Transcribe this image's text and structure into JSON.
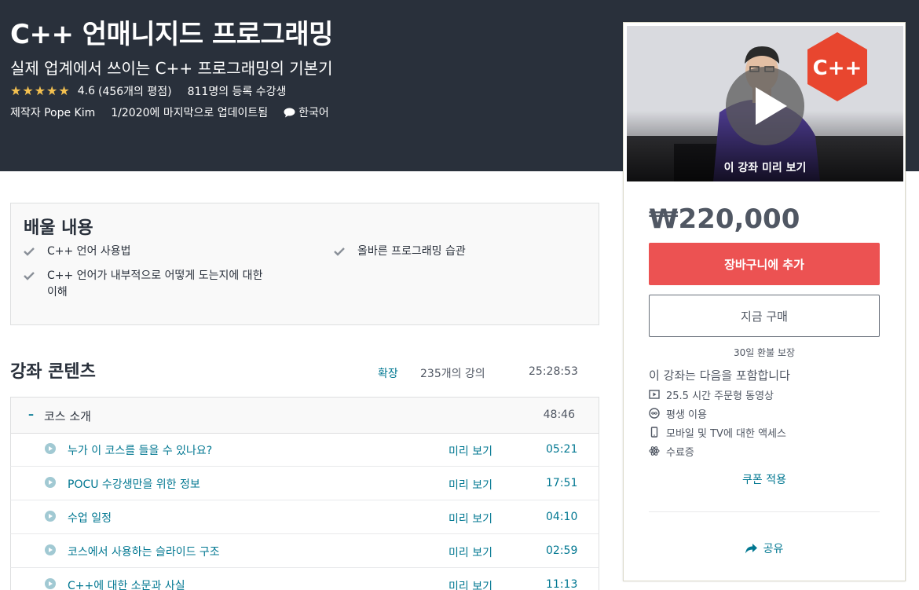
{
  "course": {
    "title": "C++ 언매니지드 프로그래밍",
    "subtitle": "실제 업계에서 쓰이는 C++ 프로그래밍의 기본기",
    "rating": "4.6",
    "rating_count": "(456개의 평점)",
    "enrollment": "811명의 등록 수강생",
    "author": "제작자 Pope Kim",
    "updated": "1/2020에 마지막으로 업데이트됨",
    "language": "한국어",
    "stars_filled": 4.6
  },
  "card": {
    "preview_label": "이 강좌 미리 보기",
    "thumbnail_logo": "C++",
    "price": "₩220,000",
    "add_to_cart": "장바구니에 추가",
    "buy_now": "지금 구매",
    "guarantee": "30일 환불 보장",
    "includes_title": "이 강좌는 다음을 포함합니다",
    "includes": [
      {
        "icon": "video-icon",
        "label": "25.5 시간 주문형 동영상"
      },
      {
        "icon": "infinity-icon",
        "label": "평생 이용"
      },
      {
        "icon": "mobile-icon",
        "label": "모바일 및 TV에 대한 액세스"
      },
      {
        "icon": "certificate-icon",
        "label": "수료증"
      }
    ],
    "coupon": "쿠폰 적용",
    "share": "공유"
  },
  "learn": {
    "title": "배울 내용",
    "items": [
      "C++ 언어 사용법",
      "올바른 프로그래밍 습관",
      "C++ 언어가 내부적으로 어떻게 도는지에 대한 이해"
    ]
  },
  "contents": {
    "title": "강좌 콘텐츠",
    "expand": "확장",
    "lecture_count": "235개의 강의",
    "total_length": "25:28:53",
    "section": {
      "toggle": "–",
      "title": "코스 소개",
      "length": "48:46"
    },
    "lectures": [
      {
        "title": "누가 이 코스를 들을 수 있나요?",
        "preview": "미리 보기",
        "length": "05:21"
      },
      {
        "title": "POCU 수강생만을 위한 정보",
        "preview": "미리 보기",
        "length": "17:51"
      },
      {
        "title": "수업 일정",
        "preview": "미리 보기",
        "length": "04:10"
      },
      {
        "title": "코스에서 사용하는 슬라이드 구조",
        "preview": "미리 보기",
        "length": "02:59"
      },
      {
        "title": "C++에 대한 소문과 사실",
        "preview": "미리 보기",
        "length": "11:13"
      }
    ]
  },
  "colors": {
    "hero_bg": "#29303b",
    "star": "#f4c150",
    "cart_button": "#ec5252",
    "link": "#007791",
    "cpp_logo": "#e8462f"
  }
}
